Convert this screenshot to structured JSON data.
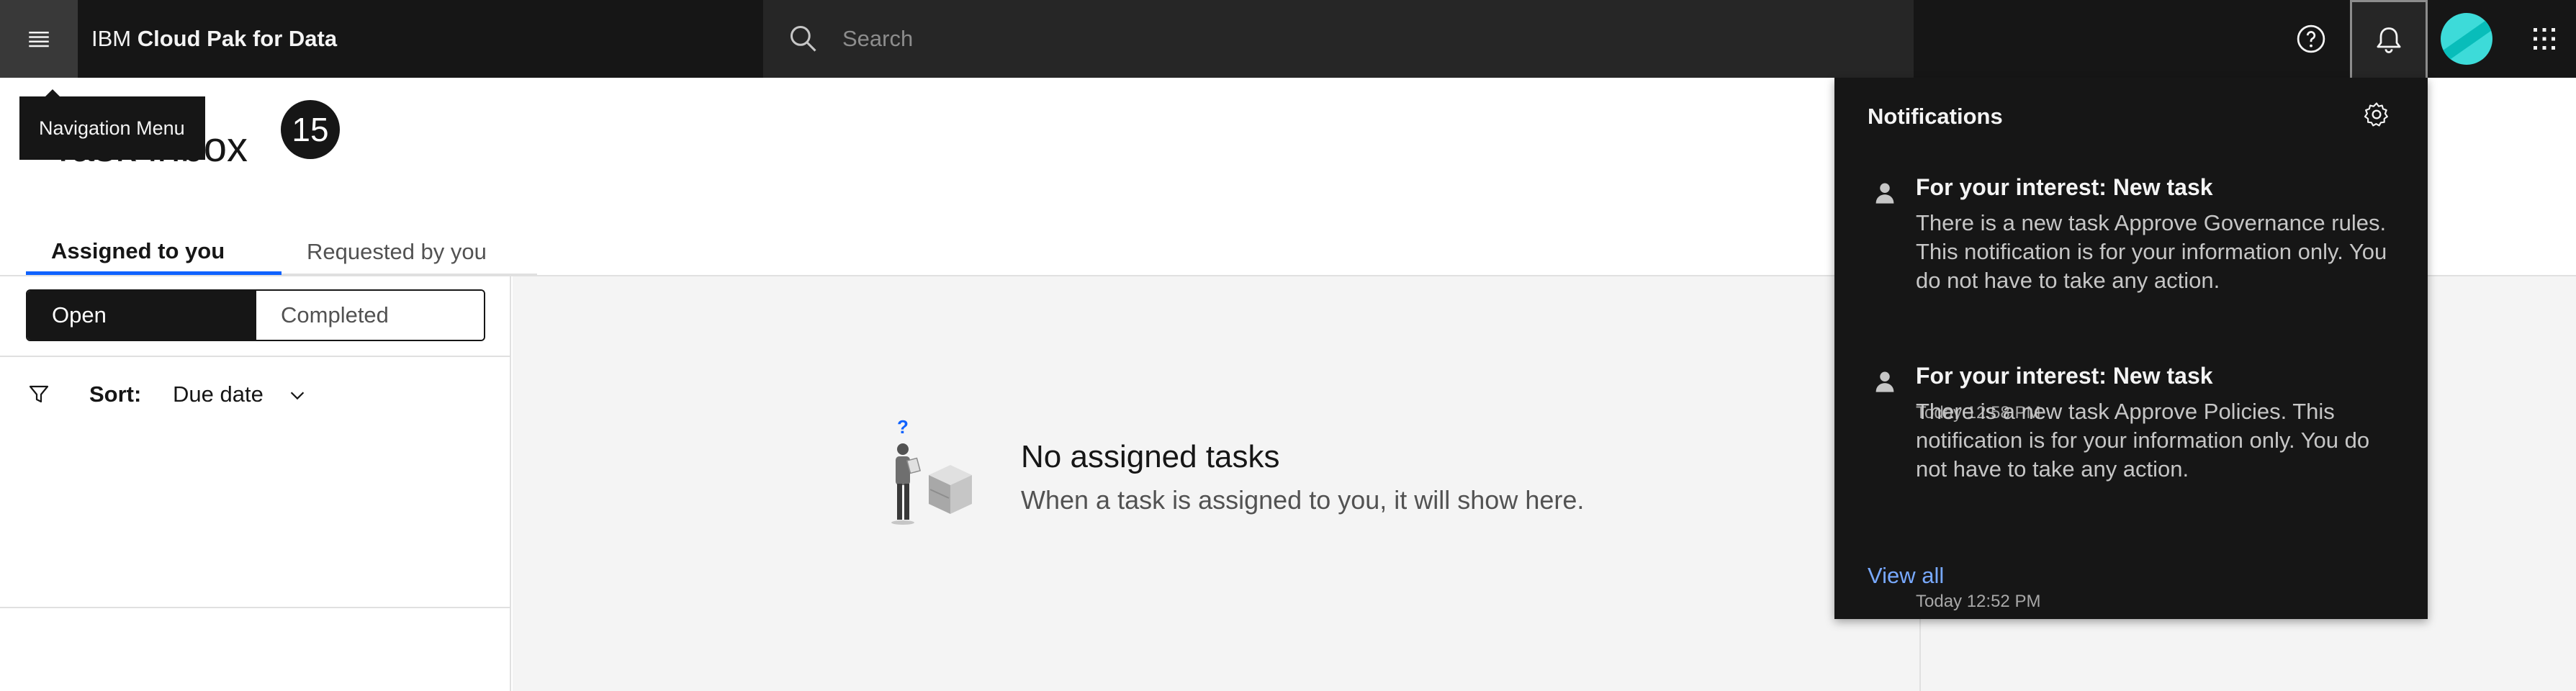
{
  "header": {
    "brand_prefix": "IBM",
    "brand_name": "Cloud Pak for Data",
    "search_placeholder": "Search"
  },
  "tooltip": {
    "text": "Navigation Menu"
  },
  "page": {
    "title": "Task inbox",
    "badge_count": "15"
  },
  "tabs": [
    {
      "label": "Assigned to you",
      "selected": true
    },
    {
      "label": "Requested by you",
      "selected": false
    }
  ],
  "status_switcher": {
    "options": [
      "Open",
      "Completed"
    ],
    "selected": "Open"
  },
  "sort": {
    "label": "Sort:",
    "value": "Due date"
  },
  "empty_state": {
    "title": "No assigned tasks",
    "subtitle": "When a task is assigned to you, it will show here."
  },
  "notifications": {
    "title": "Notifications",
    "items": [
      {
        "title": "For your interest: New task",
        "body": "There is a new task Approve Governance rules. This notification is for your information only. You do not have to take any action.",
        "time": "Today 12:58 PM"
      },
      {
        "title": "For your interest: New task",
        "body": "There is a new task Approve Policies. This notification is for your information only. You do not have to take any action.",
        "time": "Today 12:52 PM"
      }
    ],
    "view_all": "View all"
  },
  "colors": {
    "header_bg": "#161616",
    "accent_blue": "#0f62fe",
    "link_blue": "#78a9ff",
    "avatar_teal": "#3ddbd9"
  },
  "icons": [
    "menu-icon",
    "search-icon",
    "help-icon",
    "notification-bell-icon",
    "avatar",
    "app-switcher-icon",
    "filter-icon",
    "chevron-down-icon",
    "settings-gear-icon",
    "person-icon"
  ]
}
